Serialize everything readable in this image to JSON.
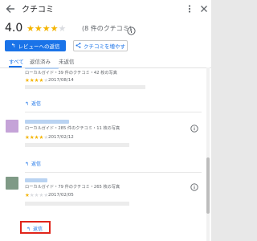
{
  "header": {
    "title": "クチコミ",
    "back_icon": "back-arrow-icon",
    "more_icon": "more-vert-icon",
    "close_icon": "close-icon"
  },
  "summary": {
    "average": "4.0",
    "stars_filled": 4,
    "stars_total": 5,
    "count_text": "(8 件のクチコミ)",
    "info_icon": "info-icon"
  },
  "actions": {
    "reply_button_label": "レビューへの返信",
    "reply_icon": "reply-icon",
    "share_button_label": "クチコミを増やす",
    "share_icon": "share-icon"
  },
  "tabs": [
    {
      "label": "すべて",
      "active": true
    },
    {
      "label": "返信済み",
      "active": false
    },
    {
      "label": "未返信",
      "active": false
    }
  ],
  "reviews": [
    {
      "meta": "ローカルガイド・39 件のクチコミ・42 枚の写真",
      "stars": 4,
      "date": "2017/08/14",
      "reply_label": "返信",
      "avatar_color": "#ffffff"
    },
    {
      "meta": "ローカルガイド・285 件のクチコミ・11 枚の写真",
      "stars": 4,
      "date": "2017/02/12",
      "reply_label": "返信",
      "avatar_color": "#c5a3d8"
    },
    {
      "meta": "ローカルガイド・79 件のクチコミ・265 枚の写真",
      "stars": 1,
      "date": "2017/02/05",
      "reply_label": "返信",
      "avatar_color": "#7f9a86"
    }
  ],
  "colors": {
    "accent": "#1a73e8",
    "star": "#f4b400",
    "highlight": "#e0251b"
  }
}
